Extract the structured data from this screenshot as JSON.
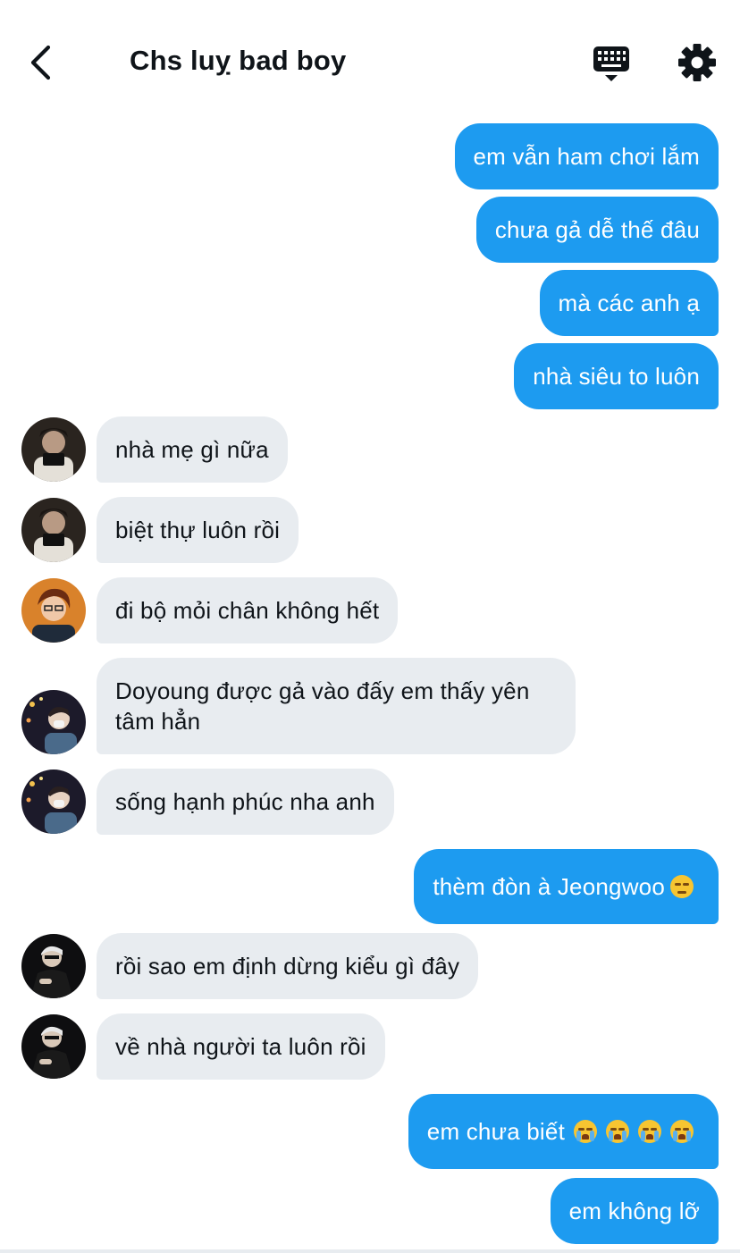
{
  "header": {
    "title": "Chs luỵ bad boy",
    "back_icon": "chevron-left-icon",
    "keyboard_icon": "keyboard-icon",
    "settings_icon": "gear-icon"
  },
  "colors": {
    "outgoing_bubble": "#1d9bf0",
    "incoming_bubble": "#e8ecf0",
    "text_dark": "#0f1419"
  },
  "messages": [
    {
      "direction": "out",
      "text": "em vẫn ham chơi lắm"
    },
    {
      "direction": "out",
      "text": "chưa gả dễ thế đâu"
    },
    {
      "direction": "out",
      "text": "mà các anh ạ"
    },
    {
      "direction": "out",
      "text": "nhà siêu to luôn"
    },
    {
      "direction": "in",
      "text": "nhà mẹ gì nữa"
    },
    {
      "direction": "in",
      "text": "biệt thự luôn rồi"
    },
    {
      "direction": "in",
      "text": "đi bộ mỏi chân không hết"
    },
    {
      "direction": "in",
      "text": "Doyoung được gả vào đấy em thấy yên tâm hẳn"
    },
    {
      "direction": "in",
      "text": "sống hạnh phúc nha anh"
    },
    {
      "direction": "out",
      "text": "thèm đòn à Jeongwoo",
      "emoji": "unamused-face"
    },
    {
      "direction": "in",
      "text": "rồi sao em định dừng kiểu gì đây"
    },
    {
      "direction": "in",
      "text": "về nhà người ta luôn rồi"
    },
    {
      "direction": "out",
      "text": "em chưa biết",
      "emoji": "loudly-crying-face x4"
    },
    {
      "direction": "out",
      "text": "em không lỡ"
    }
  ]
}
